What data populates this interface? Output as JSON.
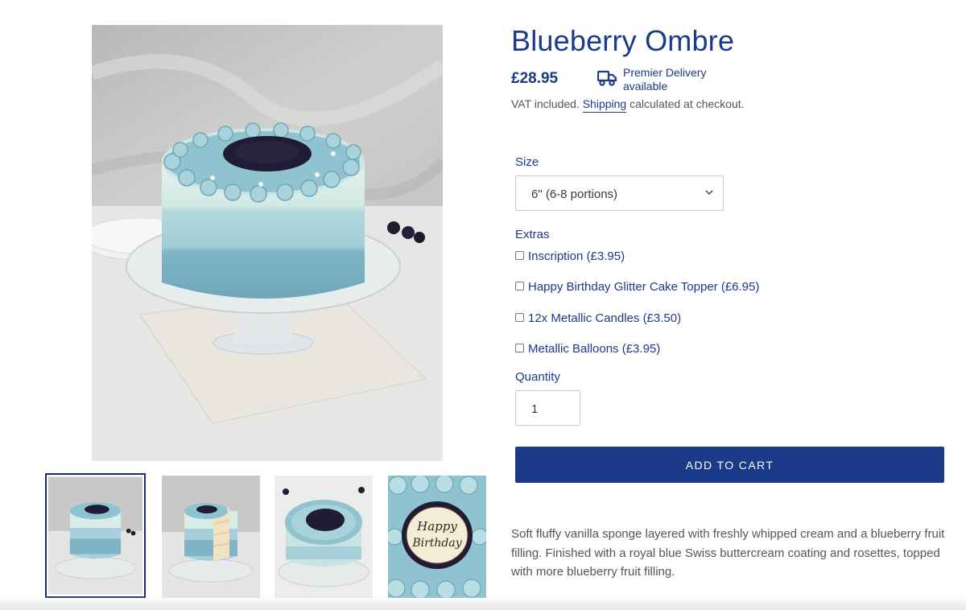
{
  "product": {
    "title": "Blueberry Ombre",
    "price": "£28.95",
    "delivery_line1": "Premier Delivery",
    "delivery_line2": "available",
    "tax_prefix": "VAT included.",
    "shipping_link": "Shipping",
    "tax_suffix": "calculated at checkout."
  },
  "icons": {
    "delivery": "truck-icon",
    "select_arrow": "chevron-down-icon"
  },
  "options": {
    "size_label": "Size",
    "size_selected": "6\" (6-8 portions)",
    "extras_label": "Extras",
    "extras": [
      {
        "label": "Inscription (£3.95)",
        "checked": false
      },
      {
        "label": "Happy Birthday Glitter Cake Topper (£6.95)",
        "checked": false
      },
      {
        "label": "12x Metallic Candles (£3.50)",
        "checked": false
      },
      {
        "label": "Metallic Balloons (£3.95)",
        "checked": false
      }
    ],
    "quantity_label": "Quantity",
    "quantity_value": "1"
  },
  "cart_button": "ADD TO CART",
  "description": "Soft fluffy vanilla sponge layered with freshly whipped cream and a blueberry fruit filling. Finished with a royal blue Swiss buttercream coating and rosettes, topped with more blueberry fruit filling.",
  "gallery": {
    "thumbnails": 4,
    "selected_index": 0,
    "topper_text": [
      "Happy",
      "Birthday"
    ]
  },
  "colors": {
    "brand_blue": "#1b3a8a",
    "frosting_mint": "#d6ece8",
    "frosting_blue": "#7fb5c6"
  }
}
